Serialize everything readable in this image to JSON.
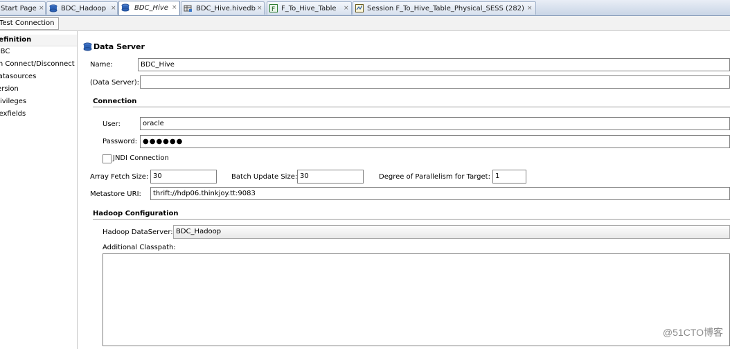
{
  "tabs": [
    {
      "label": "Start Page",
      "icon": "start-page-icon"
    },
    {
      "label": "BDC_Hadoop",
      "icon": "data-server-icon"
    },
    {
      "label": "BDC_Hive",
      "icon": "data-server-icon"
    },
    {
      "label": "BDC_Hive.hivedb",
      "icon": "schema-icon"
    },
    {
      "label": "F_To_Hive_Table",
      "icon": "mapping-icon"
    },
    {
      "label": "Session F_To_Hive_Table_Physical_SESS (282)",
      "icon": "session-icon"
    }
  ],
  "tab_close_glyph": "×",
  "toolbar": {
    "connect_label": "Test Connection"
  },
  "nav": {
    "items": [
      {
        "label": "Definition"
      },
      {
        "label": "JDBC"
      },
      {
        "label": "On Connect/Disconnect"
      },
      {
        "label": "Datasources"
      },
      {
        "label": "Version"
      },
      {
        "label": "Privileges"
      },
      {
        "label": "Flexfields"
      }
    ]
  },
  "form": {
    "header": "Data Server",
    "name_label": "Name:",
    "name_value": "BDC_Hive",
    "data_server_label": "(Data Server):",
    "data_server_value": "",
    "connection_section": "Connection",
    "user_label": "User:",
    "user_value": "oracle",
    "password_label": "Password:",
    "password_value": "●●●●●●",
    "jndi_label": "JNDI Connection",
    "array_fetch_label": "Array Fetch Size:",
    "array_fetch_value": "30",
    "batch_update_label": "Batch Update Size:",
    "batch_update_value": "30",
    "parallelism_label": "Degree of Parallelism for Target:",
    "parallelism_value": "1",
    "metastore_label": "Metastore URI:",
    "metastore_value": "thrift://hdp06.thinkjoy.tt:9083",
    "hadoop_section": "Hadoop Configuration",
    "hadoop_ds_label": "Hadoop DataServer:",
    "hadoop_ds_value": "BDC_Hadoop",
    "classpath_label": "Additional Classpath:"
  },
  "watermark": "@51CTO博客",
  "colors": {
    "tabbar": "#c9d5e6",
    "server_icon": "#2f63b5",
    "active_tab": "#ffffff"
  }
}
